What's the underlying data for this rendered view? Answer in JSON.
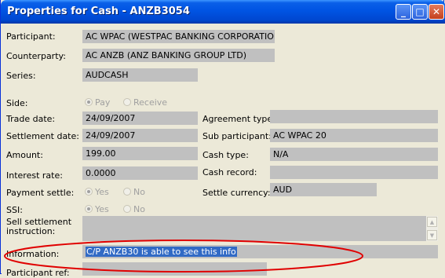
{
  "window": {
    "title": "Properties for Cash - ANZB3054"
  },
  "fields": {
    "participant": {
      "label": "Participant:",
      "value": "AC WPAC  (WESTPAC BANKING CORPORATION)"
    },
    "counterparty": {
      "label": "Counterparty:",
      "value": "AC ANZB  (ANZ BANKING GROUP LTD)"
    },
    "series": {
      "label": "Series:",
      "value": "AUDCASH"
    },
    "side": {
      "label": "Side:",
      "options": [
        "Pay",
        "Receive"
      ],
      "selected": "Pay"
    },
    "trade_date": {
      "label": "Trade date:",
      "value": "24/09/2007"
    },
    "agreement_type": {
      "label": "Agreement type:",
      "value": ""
    },
    "settlement_date": {
      "label": "Settlement date:",
      "value": "24/09/2007"
    },
    "sub_participant": {
      "label": "Sub participant:",
      "value": "AC WPAC 20"
    },
    "amount": {
      "label": "Amount:",
      "value": "199.00"
    },
    "cash_type": {
      "label": "Cash type:",
      "value": "N/A"
    },
    "interest_rate": {
      "label": "Interest rate:",
      "value": "0.0000"
    },
    "cash_record": {
      "label": "Cash record:",
      "value": ""
    },
    "payment_settle": {
      "label": "Payment settle:",
      "options": [
        "Yes",
        "No"
      ],
      "selected": "Yes"
    },
    "settle_currency": {
      "label": "Settle currency:",
      "value": "AUD"
    },
    "ssi": {
      "label": "SSI:",
      "options": [
        "Yes",
        "No"
      ],
      "selected": "Yes"
    },
    "sell_settlement_instruction": {
      "label_line1": "Sell settlement",
      "label_line2": "instruction:",
      "value": ""
    },
    "information": {
      "label": "Information:",
      "value": "C/P ANZB30 is able to see this info"
    },
    "participant_ref": {
      "label": "Participant ref:"
    }
  },
  "colors": {
    "titlebar": "#0054e3",
    "field_bg": "#c0c0c0",
    "selection": "#316ac5",
    "annotation": "#e00000"
  }
}
